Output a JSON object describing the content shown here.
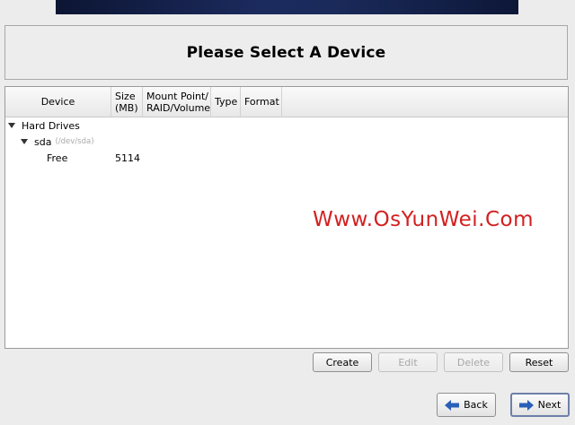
{
  "header": {
    "title": "Please Select A Device"
  },
  "table": {
    "columns": [
      "Device",
      "Size\n(MB)",
      "Mount Point/\nRAID/Volume",
      "Type",
      "Format"
    ],
    "column_lines": {
      "device": "Device",
      "size_1": "Size",
      "size_2": "(MB)",
      "mount_1": "Mount Point/",
      "mount_2": "RAID/Volume",
      "type": "Type",
      "format": "Format"
    },
    "rows": {
      "hard_drives": {
        "label": "Hard Drives"
      },
      "sda": {
        "label": "sda",
        "path": "(/dev/sda)"
      },
      "free": {
        "label": "Free",
        "size": "5114"
      }
    }
  },
  "watermark": "Www.OsYunWei.Com",
  "actions": {
    "create": "Create",
    "edit": "Edit",
    "delete": "Delete",
    "reset": "Reset"
  },
  "nav": {
    "back": "Back",
    "next": "Next"
  },
  "colors": {
    "watermark": "#d32020",
    "arrow": "#2a5fb8"
  }
}
